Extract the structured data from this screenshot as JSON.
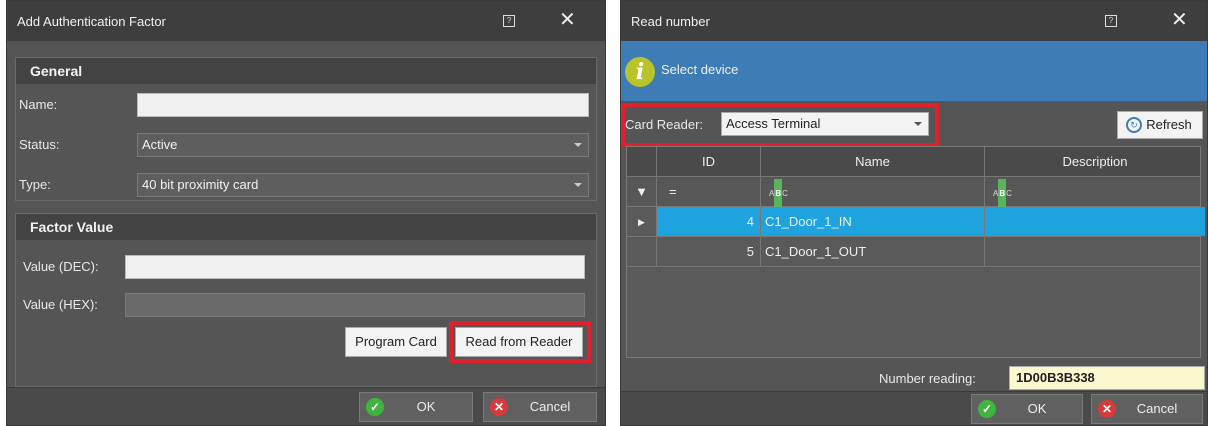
{
  "dialog1": {
    "title": "Add Authentication Factor",
    "general_header": "General",
    "name_label": "Name:",
    "name_value": "",
    "status_label": "Status:",
    "status_value": "Active",
    "type_label": "Type:",
    "type_value": "40 bit proximity card",
    "factor_header": "Factor Value",
    "value_dec_label": "Value (DEC):",
    "value_dec": "",
    "value_hex_label": "Value (HEX):",
    "value_hex": "",
    "program_card": "Program Card",
    "read_from_reader": "Read from Reader",
    "ok": "OK",
    "cancel": "Cancel"
  },
  "dialog2": {
    "title": "Read number",
    "info": "Select device",
    "card_reader_label": "Card Reader:",
    "card_reader_value": "Access Terminal",
    "refresh": "Refresh",
    "columns": [
      "ID",
      "Name",
      "Description"
    ],
    "filter_eq": "=",
    "rows": [
      {
        "id": "4",
        "name": "C1_Door_1_IN",
        "description": ""
      },
      {
        "id": "5",
        "name": "C1_Door_1_OUT",
        "description": ""
      }
    ],
    "number_reading_label": "Number reading:",
    "number_reading_value": "1D00B3B338",
    "ok": "OK",
    "cancel": "Cancel"
  },
  "icons": {
    "help": "help-icon",
    "close": "close-icon",
    "info": "info-icon",
    "refresh": "refresh-icon",
    "filter": "filter-icon",
    "ok": "check-icon",
    "cancel": "x-icon"
  },
  "colors": {
    "accent_red": "#e0202b",
    "info_bar": "#3d7cb5",
    "selected_row": "#1fa3de",
    "ok_green": "#3fb53f",
    "cancel_red": "#d83a3a"
  }
}
